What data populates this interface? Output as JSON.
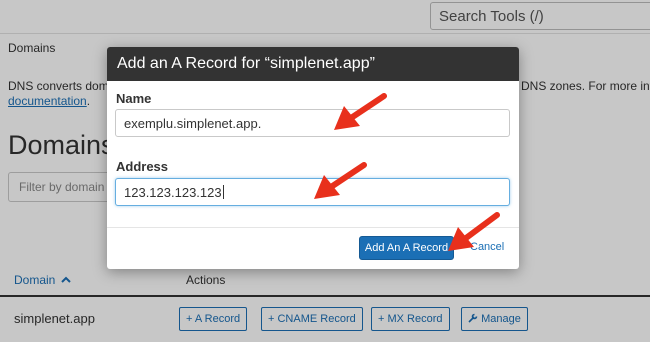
{
  "header": {
    "search_tools": "Search Tools (/)"
  },
  "breadcrumb": "Domains",
  "description": {
    "left_line1": "DNS converts dom",
    "left_link": "documentation",
    "left_line2_suffix": ".",
    "right_text": "DNS zones. For more inf"
  },
  "page_title": "Domains",
  "filter": {
    "placeholder": "Filter by domain"
  },
  "table": {
    "columns": [
      "Domain",
      "Actions"
    ],
    "rows": [
      {
        "domain": "simplenet.app",
        "actions": [
          "+ A Record",
          "+ CNAME Record",
          "+ MX Record",
          "Manage"
        ]
      }
    ]
  },
  "modal": {
    "title": "Add an A Record for “simplenet.app”",
    "name_label": "Name",
    "name_value": "exemplu.simplenet.app.",
    "address_label": "Address",
    "address_value": "123.123.123.123",
    "submit_label": "Add An A Record",
    "cancel_label": "Cancel"
  },
  "colors": {
    "accent": "#1b6fb5",
    "annotation_arrow": "#e8301c",
    "modal_header": "#333333"
  },
  "icons": [
    "chevron-up-icon",
    "plus-icon",
    "wrench-icon",
    "red-arrow-annotation"
  ]
}
